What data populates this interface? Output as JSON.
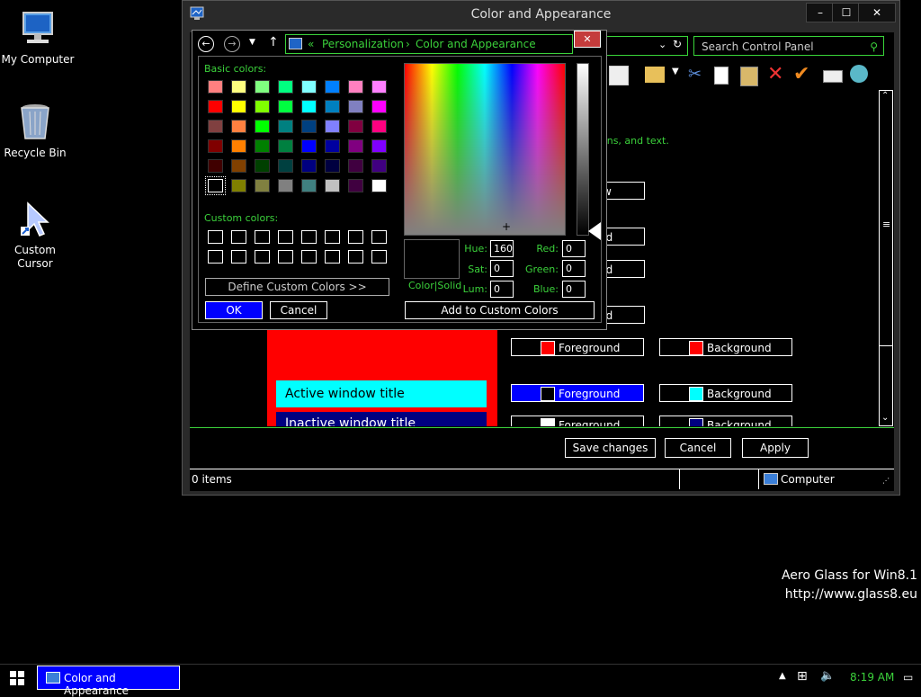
{
  "desktop": {
    "icons": [
      {
        "label": "My Computer"
      },
      {
        "label": "Recycle Bin"
      },
      {
        "label": "Custom\nCursor"
      }
    ],
    "watermark_line1": "Aero Glass for Win8.1",
    "watermark_line2": "http://www.glass8.eu"
  },
  "window": {
    "title": "Color and Appearance",
    "breadcrumb_sep": "«",
    "breadcrumb_1": "Personalization",
    "breadcrumb_arrow": "›",
    "breadcrumb_2": "Color and Appearance",
    "search_placeholder": "Search Control Panel",
    "partial_desc": "ons, and text.",
    "partial_btns": [
      "w",
      "nd",
      "nd",
      "nd"
    ],
    "color_rows": [
      {
        "fg_label": "Foreground",
        "fg_color": "#ff0000",
        "bg_label": "Background",
        "bg_color": "#ff0000",
        "fg_selected": false
      },
      {
        "fg_label": "Foreground",
        "fg_color": "#000000",
        "bg_label": "Background",
        "bg_color": "#00ffff",
        "fg_selected": true
      },
      {
        "fg_label": "Foreground",
        "fg_color": "#ffffff",
        "bg_label": "Background",
        "bg_color": "#000080",
        "fg_selected": false
      }
    ],
    "preview_active": "Active window title",
    "preview_inactive": "Inactive window title",
    "save_label": "Save changes",
    "cancel_label": "Cancel",
    "apply_label": "Apply",
    "status_items": "0 items",
    "status_location": "Computer"
  },
  "dialog": {
    "basic_colors_label": "Basic colors:",
    "custom_colors_label": "Custom colors:",
    "define_label": "Define Custom Colors >>",
    "ok_label": "OK",
    "cancel_label": "Cancel",
    "color_solid_label": "Color|Solid",
    "add_label": "Add to Custom Colors",
    "hue_label": "Hue:",
    "hue": "160",
    "sat_label": "Sat:",
    "sat": "0",
    "lum_label": "Lum:",
    "lum": "0",
    "red_label": "Red:",
    "red": "0",
    "green_label": "Green:",
    "green": "0",
    "blue_label": "Blue:",
    "blue": "0",
    "basic_colors": [
      "#ff8080",
      "#ffff80",
      "#80ff80",
      "#00ff80",
      "#80ffff",
      "#0080ff",
      "#ff80c0",
      "#ff80ff",
      "#ff0000",
      "#ffff00",
      "#80ff00",
      "#00ff40",
      "#00ffff",
      "#0080c0",
      "#8080c0",
      "#ff00ff",
      "#804040",
      "#ff8040",
      "#00ff00",
      "#008080",
      "#004080",
      "#8080ff",
      "#800040",
      "#ff0080",
      "#800000",
      "#ff8000",
      "#008000",
      "#008040",
      "#0000ff",
      "#0000a0",
      "#800080",
      "#8000ff",
      "#400000",
      "#804000",
      "#004000",
      "#004040",
      "#000080",
      "#000040",
      "#400040",
      "#400080",
      "#000000",
      "#808000",
      "#808040",
      "#808080",
      "#408080",
      "#c0c0c0",
      "#400040",
      "#ffffff"
    ]
  },
  "taskbar": {
    "app_label": "Color and Appearance",
    "time": "8:19 AM"
  }
}
